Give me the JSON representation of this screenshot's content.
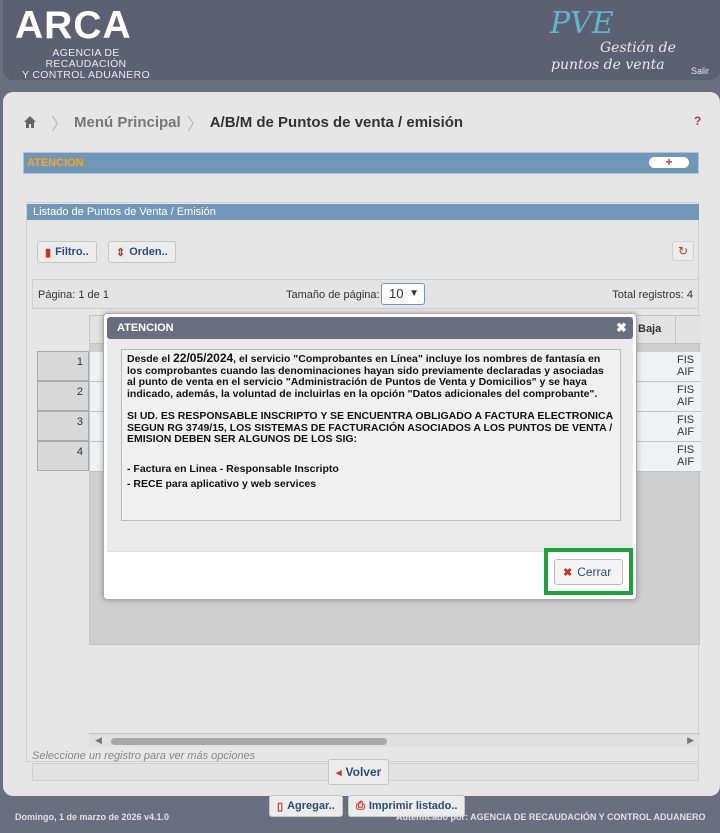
{
  "header": {
    "logo": "ARCA",
    "logo_sub_1": "AGENCIA DE RECAUDACIÓN",
    "logo_sub_2": "Y CONTROL ADUANERO",
    "app_name": "PVE",
    "app_sub_1": "Gestión de",
    "app_sub_2": "puntos de venta",
    "salir": "Salir"
  },
  "breadcrumb": {
    "menu": "Menú Principal",
    "current": "A/B/M de Puntos de venta / emisión",
    "help": "?"
  },
  "atencion_bar": {
    "label": "ATENCION",
    "toggle": "+"
  },
  "list": {
    "title": "Listado de Puntos de Venta / Emisión",
    "filter_btn": "Filtro..",
    "order_btn": "Orden..",
    "page_label": "Página: 1 de 1",
    "page_size_label": "Tamaño de página:",
    "page_size_value": "10",
    "total_label": "Total registros: 4",
    "col_baja": "Baja",
    "row_numbers": [
      "1",
      "2",
      "3",
      "4"
    ],
    "row_right_cells": [
      {
        "l1": "FIS",
        "l2": "AIF"
      },
      {
        "l1": "FIS",
        "l2": "AIF"
      },
      {
        "l1": "FIS",
        "l2": "AIF"
      },
      {
        "l1": "FIS",
        "l2": "AIF"
      }
    ],
    "select_hint": "Seleccione un registro para ver más opciones",
    "add_btn": "Agregar..",
    "print_btn": "Imprimir listado.."
  },
  "back_btn": "Volver",
  "modal": {
    "title": "ATENCION",
    "p1_pre": "Desde el ",
    "p1_date": "22/05/2024",
    "p1_post": ", el servicio \"Comprobantes en Línea\" incluye los nombres de fantasía en los comprobantes cuando las denominaciones hayan sido previamente declaradas y asociadas al punto de venta en el servicio \"Administración de Puntos de Venta y Domicilios\" y se haya indicado, además, la voluntad de incluirlas en la opción \"Datos adicionales del comprobante\".",
    "p2": "SI UD. ES RESPONSABLE INSCRIPTO Y SE ENCUENTRA OBLIGADO A FACTURA ELECTRONICA SEGUN RG 3749/15, LOS SISTEMAS DE FACTURACIÓN ASOCIADOS A LOS PUNTOS DE VENTA / EMISION DEBEN SER ALGUNOS DE LOS SIG:",
    "items": [
      "- Factura en Linea - Responsable Inscripto",
      "- RECE para aplicativo y web services"
    ],
    "close_btn": "Cerrar"
  },
  "footer": {
    "left": "Domingo, 1 de marzo de 2026 v4.1.0",
    "right": "Autenticado por: AGENCIA DE RECAUDACIÓN Y CONTROL ADUANERO"
  },
  "colors": {
    "header_bg": "#5d6072",
    "accent_blue": "#7296b8",
    "highlight_green": "#22a040",
    "alert_orange": "#f5a623"
  }
}
